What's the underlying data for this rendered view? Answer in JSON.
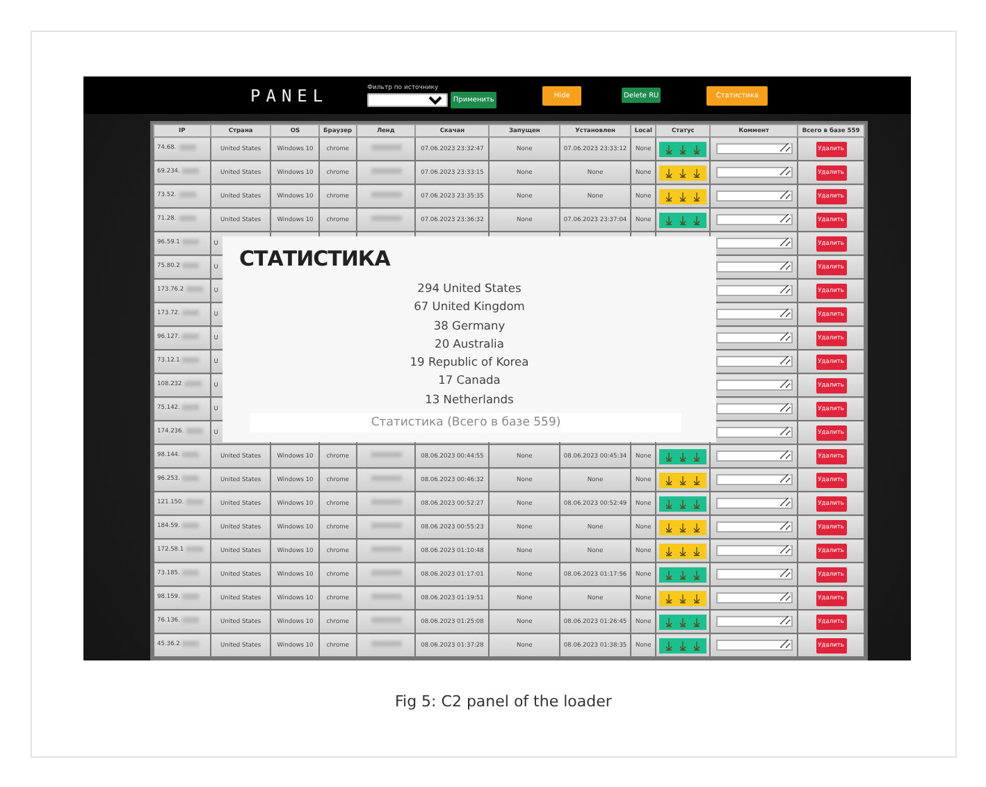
{
  "panel": {
    "logo": "PANEL",
    "filter_label": "Фильтр по источнику",
    "apply_button": "Применить",
    "buttons": [
      {
        "label": "Hide",
        "color": "#f7a01c"
      },
      {
        "label": "Delete RU",
        "color": "#1e8a4c"
      },
      {
        "label": "Статистика",
        "color": "#f7a01c"
      }
    ]
  },
  "table": {
    "columns": [
      "IP",
      "Страна",
      "OS",
      "Браузер",
      "Ленд",
      "Скачан",
      "Запущен",
      "Установлен",
      "Local",
      "Статус",
      "Коммент",
      "Всего в базе 559"
    ],
    "rows": [
      {
        "ip": "74.68.",
        "country": "United States",
        "os": "Windows 10",
        "browser": "chrome",
        "land_blurred": true,
        "downloaded": "07.06.2023 23:32:47",
        "launched": "None",
        "installed": "07.06.2023 23:33:12",
        "local": "None",
        "color": "#1dbf8e",
        "action": "Удалить"
      },
      {
        "ip": "69.234.",
        "country": "United States",
        "os": "Windows 10",
        "browser": "chrome",
        "land_blurred": true,
        "downloaded": "07.06.2023 23:33:15",
        "launched": "None",
        "installed": "None",
        "local": "None",
        "color": "#f8c81c",
        "action": "Удалить"
      },
      {
        "ip": "73.52.",
        "country": "United States",
        "os": "Windows 10",
        "browser": "chrome",
        "land_blurred": true,
        "downloaded": "07.06.2023 23:35:35",
        "launched": "None",
        "installed": "None",
        "local": "None",
        "color": "#f8c81c",
        "action": "Удалить"
      },
      {
        "ip": "71.28.",
        "country": "United States",
        "os": "Windows 10",
        "browser": "chrome",
        "land_blurred": true,
        "downloaded": "07.06.2023 23:36:32",
        "launched": "None",
        "installed": "07.06.2023 23:37:04",
        "local": "None",
        "color": "#1dbf8e",
        "action": "Удалить"
      },
      {
        "ip": "96.59.1",
        "country": "U",
        "action": "Удалить"
      },
      {
        "ip": "75.80.2",
        "country": "U",
        "action": "Удалить"
      },
      {
        "ip": "173.76.2",
        "country": "U",
        "action": "Удалить"
      },
      {
        "ip": "173.72.",
        "country": "U",
        "action": "Удалить"
      },
      {
        "ip": "96.127.",
        "country": "U",
        "action": "Удалить"
      },
      {
        "ip": "73.12.1",
        "country": "U",
        "action": "Удалить"
      },
      {
        "ip": "108.232",
        "country": "U",
        "action": "Удалить"
      },
      {
        "ip": "75.142.",
        "country": "U",
        "action": "Удалить"
      },
      {
        "ip": "174.236.",
        "country": "U",
        "action": "Удалить"
      },
      {
        "ip": "98.144.",
        "country": "United States",
        "os": "Windows 10",
        "browser": "chrome",
        "land_blurred": true,
        "downloaded": "08.06.2023 00:44:55",
        "launched": "None",
        "installed": "08.06.2023 00:45:34",
        "local": "None",
        "color": "#1dbf8e",
        "action": "Удалить"
      },
      {
        "ip": "96.253.",
        "country": "United States",
        "os": "Windows 10",
        "browser": "chrome",
        "land_blurred": true,
        "downloaded": "08.06.2023 00:46:32",
        "launched": "None",
        "installed": "None",
        "local": "None",
        "color": "#f8c81c",
        "action": "Удалить"
      },
      {
        "ip": "121.150.",
        "country": "United States",
        "os": "Windows 10",
        "browser": "chrome",
        "land_blurred": true,
        "downloaded": "08.06.2023 00:52:27",
        "launched": "None",
        "installed": "08.06.2023 00:52:49",
        "local": "None",
        "color": "#1dbf8e",
        "action": "Удалить"
      },
      {
        "ip": "184.59.",
        "country": "United States",
        "os": "Windows 10",
        "browser": "chrome",
        "land_blurred": true,
        "downloaded": "08.06.2023 00:55:23",
        "launched": "None",
        "installed": "None",
        "local": "None",
        "color": "#f8c81c",
        "action": "Удалить"
      },
      {
        "ip": "172.58.1",
        "country": "United States",
        "os": "Windows 10",
        "browser": "chrome",
        "land_blurred": true,
        "downloaded": "08.06.2023 01:10:48",
        "launched": "None",
        "installed": "None",
        "local": "None",
        "color": "#f8c81c",
        "action": "Удалить"
      },
      {
        "ip": "73.185.",
        "country": "United States",
        "os": "Windows 10",
        "browser": "chrome",
        "land_blurred": true,
        "downloaded": "08.06.2023 01:17:01",
        "launched": "None",
        "installed": "08.06.2023 01:17:56",
        "local": "None",
        "color": "#1dbf8e",
        "action": "Удалить"
      },
      {
        "ip": "98.159.",
        "country": "United States",
        "os": "Windows 10",
        "browser": "chrome",
        "land_blurred": true,
        "downloaded": "08.06.2023 01:19:51",
        "launched": "None",
        "installed": "None",
        "local": "None",
        "color": "#f8c81c",
        "action": "Удалить"
      },
      {
        "ip": "76.136.",
        "country": "United States",
        "os": "Windows 10",
        "browser": "chrome",
        "land_blurred": true,
        "downloaded": "08.06.2023 01:25:08",
        "launched": "None",
        "installed": "08.06.2023 01:26:45",
        "local": "None",
        "color": "#1dbf8e",
        "action": "Удалить"
      },
      {
        "ip": "45.36.2",
        "country": "United States",
        "os": "Windows 10",
        "browser": "chrome",
        "land_blurred": true,
        "downloaded": "08.06.2023 01:37:28",
        "launched": "None",
        "installed": "08.06.2023 01:38:35",
        "local": "None",
        "color": "#1dbf8e",
        "action": "Удалить"
      }
    ]
  },
  "stats": {
    "title": "СТАТИСТИКА",
    "lines": [
      "294 United States",
      "67 United Kingdom",
      "38 Germany",
      "20 Australia",
      "19 Republic of Korea",
      "17 Canada",
      "13 Netherlands"
    ],
    "footer": "Статистика (Всего в базе 559)"
  },
  "figure": {
    "caption": "Fig 5: C2 panel of the loader"
  }
}
